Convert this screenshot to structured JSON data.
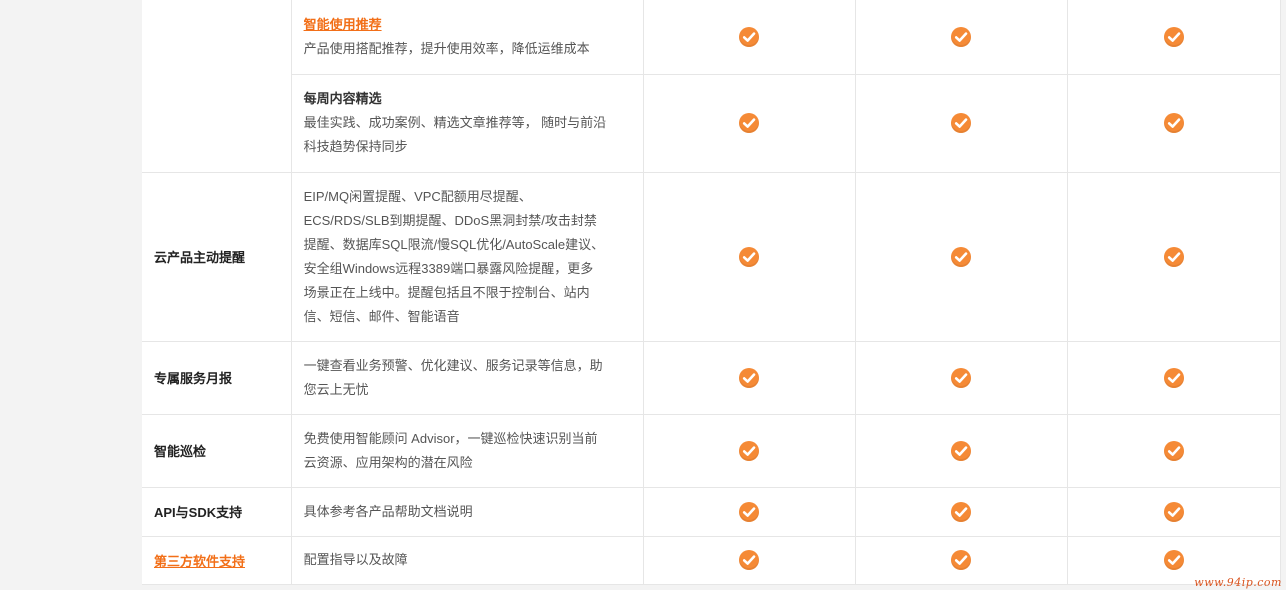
{
  "rows": [
    {
      "category": "",
      "title": "智能使用推荐",
      "title_link": true,
      "desc_lines": [
        "产品使用搭配推荐，提升使用效率，降低运维成本"
      ],
      "checks": 3
    },
    {
      "category": "",
      "title": "每周内容精选",
      "title_link": false,
      "desc_lines": [
        "最佳实践、成功案例、精选文章推荐等， 随时与前沿",
        "科技趋势保持同步"
      ],
      "checks": 3
    },
    {
      "category": "云产品主动提醒",
      "title": "",
      "desc_lines": [
        "EIP/MQ闲置提醒、VPC配额用尽提醒、",
        "ECS/RDS/SLB到期提醒、DDoS黑洞封禁/攻击封禁",
        "提醒、数据库SQL限流/慢SQL优化/AutoScale建议、",
        "安全组Windows远程3389端口暴露风险提醒，更多",
        "场景正在上线中。提醒包括且不限于控制台、站内",
        "信、短信、邮件、智能语音"
      ],
      "checks": 3
    },
    {
      "category": "专属服务月报",
      "title": "",
      "desc_lines": [
        "一键查看业务预警、优化建议、服务记录等信息，助",
        "您云上无忧"
      ],
      "checks": 3
    },
    {
      "category": "智能巡检",
      "title": "",
      "desc_lines": [
        "免费使用智能顾问 Advisor，一键巡检快速识别当前",
        "云资源、应用架构的潜在风险"
      ],
      "checks": 3
    },
    {
      "category": "API与SDK支持",
      "title": "",
      "desc_lines": [
        "具体参考各产品帮助文档说明"
      ],
      "checks": 3
    },
    {
      "category": "第三方软件支持",
      "category_link": true,
      "title": "",
      "desc_lines": [
        "配置指导以及故障"
      ],
      "checks": 3
    }
  ],
  "icon": "check-circle-icon",
  "accent_color": "#f58a36",
  "watermark": "www.94ip.com"
}
